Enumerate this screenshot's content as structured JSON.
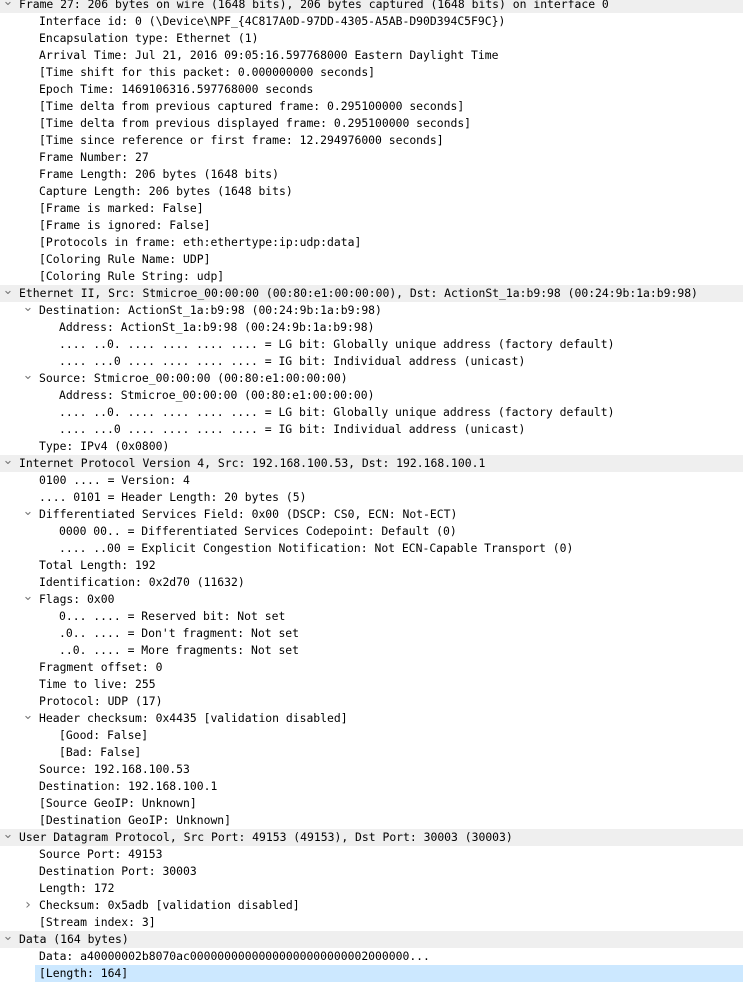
{
  "colors": {
    "header_bg": "#efefef",
    "selection_bg": "#cce8ff",
    "chevron": "#777777",
    "text": "#000000"
  },
  "icons": {
    "expanded": "chevron-down-icon",
    "collapsed": "chevron-right-icon"
  },
  "tree": [
    {
      "level": 0,
      "header": true,
      "expander": "expanded",
      "text": "Frame 27: 206 bytes on wire (1648 bits), 206 bytes captured (1648 bits) on interface 0"
    },
    {
      "level": 1,
      "text": "Interface id: 0 (\\Device\\NPF_{4C817A0D-97DD-4305-A5AB-D90D394C5F9C})"
    },
    {
      "level": 1,
      "text": "Encapsulation type: Ethernet (1)"
    },
    {
      "level": 1,
      "text": "Arrival Time: Jul 21, 2016 09:05:16.597768000 Eastern Daylight Time"
    },
    {
      "level": 1,
      "text": "[Time shift for this packet: 0.000000000 seconds]"
    },
    {
      "level": 1,
      "text": "Epoch Time: 1469106316.597768000 seconds"
    },
    {
      "level": 1,
      "text": "[Time delta from previous captured frame: 0.295100000 seconds]"
    },
    {
      "level": 1,
      "text": "[Time delta from previous displayed frame: 0.295100000 seconds]"
    },
    {
      "level": 1,
      "text": "[Time since reference or first frame: 12.294976000 seconds]"
    },
    {
      "level": 1,
      "text": "Frame Number: 27"
    },
    {
      "level": 1,
      "text": "Frame Length: 206 bytes (1648 bits)"
    },
    {
      "level": 1,
      "text": "Capture Length: 206 bytes (1648 bits)"
    },
    {
      "level": 1,
      "text": "[Frame is marked: False]"
    },
    {
      "level": 1,
      "text": "[Frame is ignored: False]"
    },
    {
      "level": 1,
      "text": "[Protocols in frame: eth:ethertype:ip:udp:data]"
    },
    {
      "level": 1,
      "text": "[Coloring Rule Name: UDP]"
    },
    {
      "level": 1,
      "text": "[Coloring Rule String: udp]"
    },
    {
      "level": 0,
      "header": true,
      "expander": "expanded",
      "text": "Ethernet II, Src: Stmicroe_00:00:00 (00:80:e1:00:00:00), Dst: ActionSt_1a:b9:98 (00:24:9b:1a:b9:98)"
    },
    {
      "level": 1,
      "expander": "expanded",
      "text": "Destination: ActionSt_1a:b9:98 (00:24:9b:1a:b9:98)"
    },
    {
      "level": 2,
      "text": "Address: ActionSt_1a:b9:98 (00:24:9b:1a:b9:98)"
    },
    {
      "level": 2,
      "text": ".... ..0. .... .... .... .... = LG bit: Globally unique address (factory default)"
    },
    {
      "level": 2,
      "text": ".... ...0 .... .... .... .... = IG bit: Individual address (unicast)"
    },
    {
      "level": 1,
      "expander": "expanded",
      "text": "Source: Stmicroe_00:00:00 (00:80:e1:00:00:00)"
    },
    {
      "level": 2,
      "text": "Address: Stmicroe_00:00:00 (00:80:e1:00:00:00)"
    },
    {
      "level": 2,
      "text": ".... ..0. .... .... .... .... = LG bit: Globally unique address (factory default)"
    },
    {
      "level": 2,
      "text": ".... ...0 .... .... .... .... = IG bit: Individual address (unicast)"
    },
    {
      "level": 1,
      "text": "Type: IPv4 (0x0800)"
    },
    {
      "level": 0,
      "header": true,
      "expander": "expanded",
      "text": "Internet Protocol Version 4, Src: 192.168.100.53, Dst: 192.168.100.1"
    },
    {
      "level": 1,
      "text": "0100 .... = Version: 4"
    },
    {
      "level": 1,
      "text": ".... 0101 = Header Length: 20 bytes (5)"
    },
    {
      "level": 1,
      "expander": "expanded",
      "text": "Differentiated Services Field: 0x00 (DSCP: CS0, ECN: Not-ECT)"
    },
    {
      "level": 2,
      "text": "0000 00.. = Differentiated Services Codepoint: Default (0)"
    },
    {
      "level": 2,
      "text": ".... ..00 = Explicit Congestion Notification: Not ECN-Capable Transport (0)"
    },
    {
      "level": 1,
      "text": "Total Length: 192"
    },
    {
      "level": 1,
      "text": "Identification: 0x2d70 (11632)"
    },
    {
      "level": 1,
      "expander": "expanded",
      "text": "Flags: 0x00"
    },
    {
      "level": 2,
      "text": "0... .... = Reserved bit: Not set"
    },
    {
      "level": 2,
      "text": ".0.. .... = Don't fragment: Not set"
    },
    {
      "level": 2,
      "text": "..0. .... = More fragments: Not set"
    },
    {
      "level": 1,
      "text": "Fragment offset: 0"
    },
    {
      "level": 1,
      "text": "Time to live: 255"
    },
    {
      "level": 1,
      "text": "Protocol: UDP (17)"
    },
    {
      "level": 1,
      "expander": "expanded",
      "text": "Header checksum: 0x4435 [validation disabled]"
    },
    {
      "level": 2,
      "text": "[Good: False]"
    },
    {
      "level": 2,
      "text": "[Bad: False]"
    },
    {
      "level": 1,
      "text": "Source: 192.168.100.53"
    },
    {
      "level": 1,
      "text": "Destination: 192.168.100.1"
    },
    {
      "level": 1,
      "text": "[Source GeoIP: Unknown]"
    },
    {
      "level": 1,
      "text": "[Destination GeoIP: Unknown]"
    },
    {
      "level": 0,
      "header": true,
      "expander": "expanded",
      "text": "User Datagram Protocol, Src Port: 49153 (49153), Dst Port: 30003 (30003)"
    },
    {
      "level": 1,
      "text": "Source Port: 49153"
    },
    {
      "level": 1,
      "text": "Destination Port: 30003"
    },
    {
      "level": 1,
      "text": "Length: 172"
    },
    {
      "level": 1,
      "expander": "collapsed",
      "text": "Checksum: 0x5adb [validation disabled]"
    },
    {
      "level": 1,
      "text": "[Stream index: 3]"
    },
    {
      "level": 0,
      "header": true,
      "expander": "expanded",
      "text": "Data (164 bytes)"
    },
    {
      "level": 1,
      "text": "Data: a40000002b8070ac00000000000000000000000002000000..."
    },
    {
      "level": 1,
      "selected": true,
      "text": "[Length: 164]"
    }
  ]
}
